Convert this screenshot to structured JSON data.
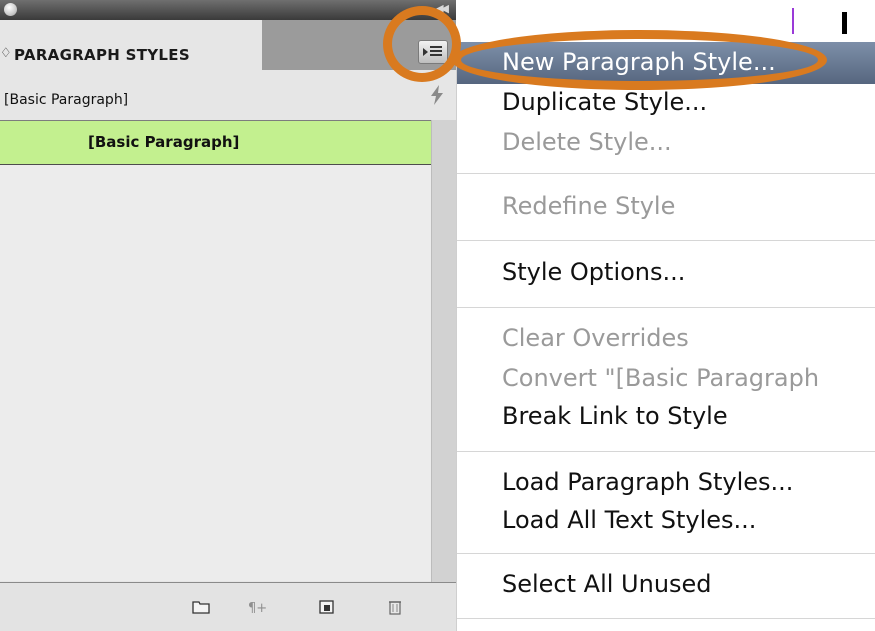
{
  "panel": {
    "tab_label": "PARAGRAPH STYLES",
    "tab_arrows": "♢",
    "current_style": "[Basic Paragraph]",
    "list_items": [
      {
        "label": "[Basic Paragraph]",
        "selected": true
      }
    ],
    "bottom_icons": [
      "folder-icon",
      "clear-overrides-icon",
      "new-style-icon",
      "trash-icon"
    ]
  },
  "menu": {
    "items": [
      {
        "label": "New Paragraph Style...",
        "state": "highlighted"
      },
      {
        "label": "Duplicate Style...",
        "state": "enabled"
      },
      {
        "label": "Delete Style...",
        "state": "disabled"
      },
      {
        "label": "Redefine Style",
        "state": "disabled"
      },
      {
        "label": "Style Options...",
        "state": "enabled"
      },
      {
        "label": "Clear Overrides",
        "state": "disabled"
      },
      {
        "label": "Convert \"[Basic Paragraph",
        "state": "disabled"
      },
      {
        "label": "Break Link to Style",
        "state": "enabled"
      },
      {
        "label": "Load Paragraph Styles...",
        "state": "enabled"
      },
      {
        "label": "Load All Text Styles...",
        "state": "enabled"
      },
      {
        "label": "Select All Unused",
        "state": "enabled"
      }
    ]
  },
  "colors": {
    "selected_row": "#c3f08f",
    "menu_highlight": "#6a7b95",
    "annotation": "#d97a1f",
    "disabled_text": "#9a9a9a"
  }
}
